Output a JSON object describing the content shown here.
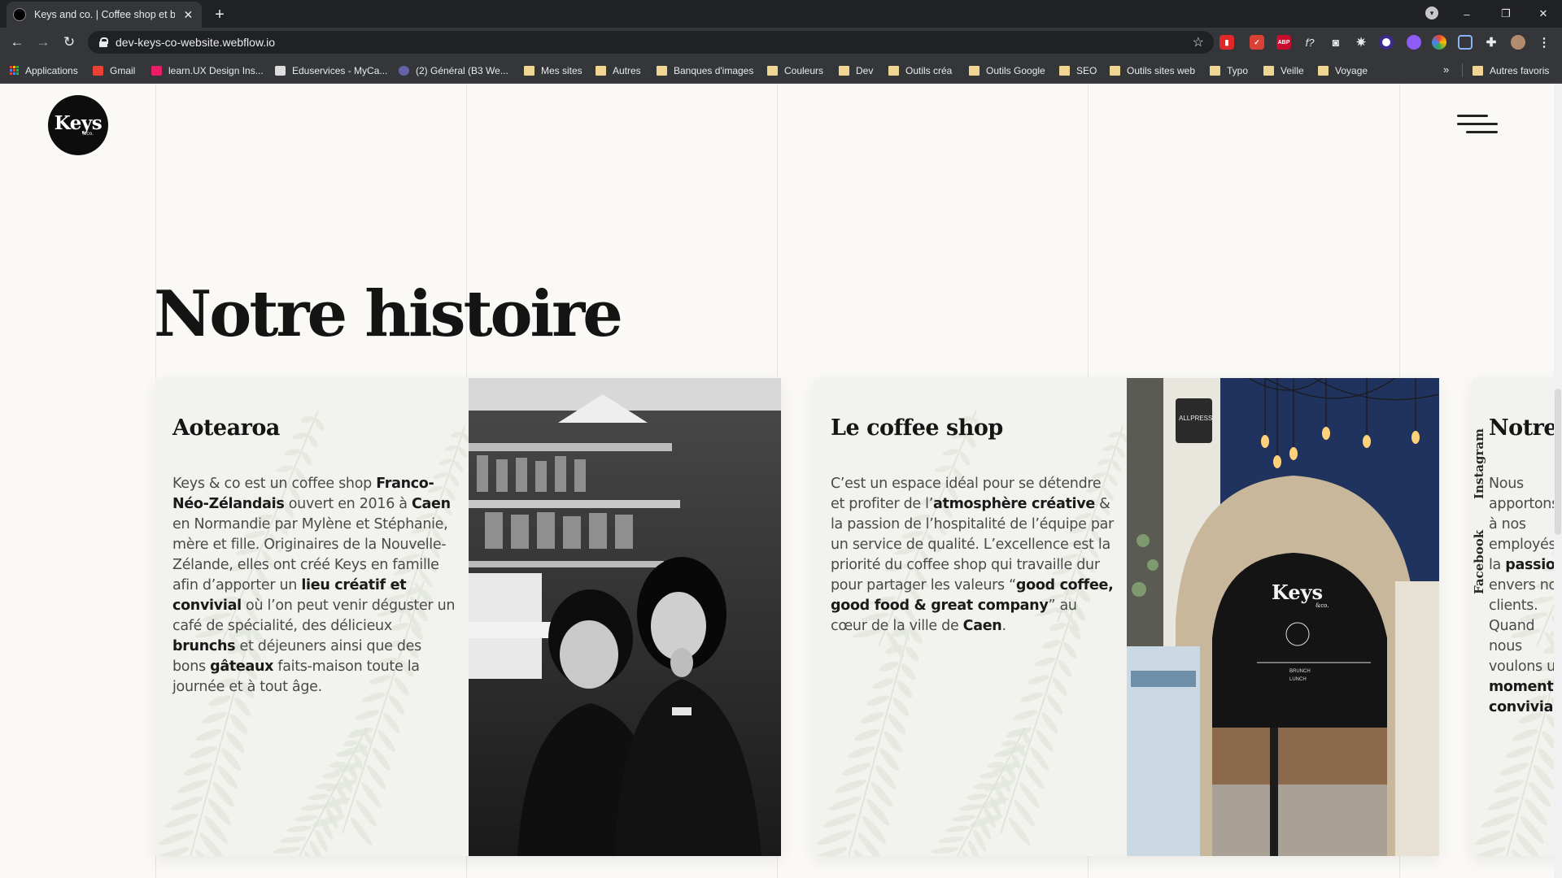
{
  "browser": {
    "tab_title": "Keys and co. | Coffee shop et brunch",
    "url": "dev-keys-co-website.webflow.io",
    "new_tab": "+",
    "tab_close": "✕",
    "window": {
      "minimize": "–",
      "restore": "❐",
      "close": "✕"
    },
    "extensions": [
      "flipboard-icon",
      "todoist-icon",
      "adblock-icon",
      "whatfont-icon",
      "camera-icon",
      "settings-icon",
      "vpn-icon",
      "gradient-icon",
      "colorzilla-icon",
      "screen-capture-icon",
      "puzzle-icon",
      "avatar-icon",
      "kebab-menu-icon"
    ],
    "extension_labels": {
      "adblock": "ABP",
      "whatfont": "f?"
    },
    "bookmarks": [
      {
        "label": "Applications",
        "icon": "apps-grid-icon"
      },
      {
        "label": "Gmail",
        "icon": "gmail-icon"
      },
      {
        "label": "learn.UX Design Ins...",
        "icon": "learnux-icon"
      },
      {
        "label": "Eduservices - MyCa...",
        "icon": "eduservices-icon"
      },
      {
        "label": "(2) Général (B3 We...",
        "icon": "teams-icon"
      },
      {
        "label": "Mes sites",
        "icon": "folder-icon"
      },
      {
        "label": "Autres",
        "icon": "folder-icon"
      },
      {
        "label": "Banques d'images",
        "icon": "folder-icon"
      },
      {
        "label": "Couleurs",
        "icon": "folder-icon"
      },
      {
        "label": "Dev",
        "icon": "folder-icon"
      },
      {
        "label": "Outils créa",
        "icon": "folder-icon"
      },
      {
        "label": "Outils Google",
        "icon": "folder-icon"
      },
      {
        "label": "SEO",
        "icon": "folder-icon"
      },
      {
        "label": "Outils sites web",
        "icon": "folder-icon"
      },
      {
        "label": "Typo",
        "icon": "folder-icon"
      },
      {
        "label": "Veille",
        "icon": "folder-icon"
      },
      {
        "label": "Voyage",
        "icon": "folder-icon"
      }
    ],
    "bookmarks_more": "»",
    "other_bookmarks": "Autres favoris"
  },
  "site": {
    "logo_word": "Keys",
    "logo_sub": "&co.",
    "page_title": "Notre histoire",
    "cards": [
      {
        "title": "Aotearoa",
        "photo": "founders-photo",
        "body": [
          {
            "t": "Keys & co est un coffee shop "
          },
          {
            "t": "Franco-Néo-Zélandais",
            "b": true
          },
          {
            "t": " ouvert en 2016 à "
          },
          {
            "t": "Caen",
            "b": true
          },
          {
            "t": " en Normandie par Mylène et Stéphanie, mère et fille. Originaires de la Nouvelle-Zélande, elles ont créé Keys en famille afin d’apporter un "
          },
          {
            "t": "lieu créatif et convivial",
            "b": true
          },
          {
            "t": " où l’on peut venir déguster un café de spécialité, des délicieux "
          },
          {
            "t": "brunchs",
            "b": true
          },
          {
            "t": " et déjeuners ainsi que des bons "
          },
          {
            "t": "gâteaux",
            "b": true
          },
          {
            "t": " faits-maison toute la journée et à tout âge."
          }
        ]
      },
      {
        "title": "Le coffee shop",
        "photo": "coffee-shop-interior-photo",
        "photo_text": {
          "shop_logo": "Keys",
          "shop_logo_sub": "&co.",
          "cup_brand": "ALLPRESS",
          "board_1": "BRUNCH",
          "board_2": "LUNCH"
        },
        "body": [
          {
            "t": "C’est un espace idéal pour se détendre et profiter de l’"
          },
          {
            "t": "atmosphère créative",
            "b": true
          },
          {
            "t": " & la passion de l’hospitalité de l’équipe par un service de qualité. L’excellence est la priorité du coffee shop qui travaille dur pour partager les valeurs “"
          },
          {
            "t": "good coffee, good food & great company",
            "b": true
          },
          {
            "t": "” au cœur de la ville de "
          },
          {
            "t": "Caen",
            "b": true
          },
          {
            "t": "."
          }
        ]
      },
      {
        "title": "Notre équipe",
        "body": [
          {
            "t": "Nous apportons à nos employés la "
          },
          {
            "t": "passion",
            "b": true
          },
          {
            "t": " envers nos clients. Quand nous voulons un "
          },
          {
            "t": "moment convivial",
            "b": true
          },
          {
            "t": "."
          }
        ]
      }
    ],
    "social": {
      "instagram": "Instagram",
      "facebook": "Facebook"
    },
    "menu_icon": "hamburger-menu-icon"
  }
}
